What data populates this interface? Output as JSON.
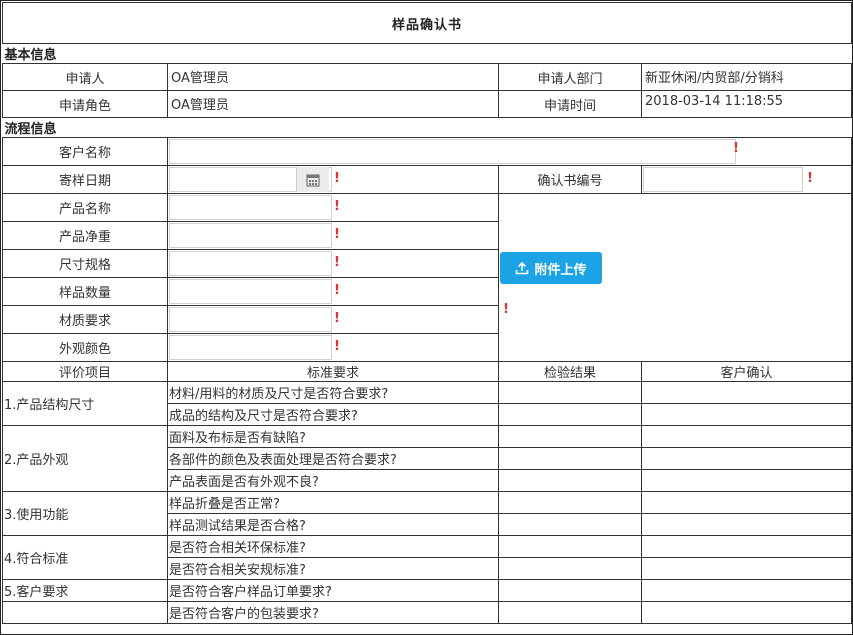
{
  "title": "样品确认书",
  "basic": {
    "section": "基本信息",
    "applicant_label": "申请人",
    "applicant_value": "OA管理员",
    "dept_label": "申请人部门",
    "dept_value": "新亚休闲/内贸部/分销科",
    "role_label": "申请角色",
    "role_value": "OA管理员",
    "time_label": "申请时间",
    "time_value": "2018-03-14 11:18:55"
  },
  "flow": {
    "section": "流程信息",
    "customer_name_label": "客户名称",
    "send_date_label": "寄样日期",
    "confirm_no_label": "确认书编号",
    "product_name_label": "产品名称",
    "net_weight_label": "产品净重",
    "size_label": "尺寸规格",
    "qty_label": "样品数量",
    "material_label": "材质要求",
    "color_label": "外观颜色",
    "upload_label": "附件上传",
    "required_mark": "!"
  },
  "eval": {
    "headers": [
      "评价项目",
      "标准要求",
      "检验结果",
      "客户确认"
    ],
    "groups": [
      {
        "item": "1.产品结构尺寸",
        "rows": [
          "材料/用料的材质及尺寸是否符合要求?",
          "成品的结构及尺寸是否符合要求?"
        ]
      },
      {
        "item": "2.产品外观",
        "rows": [
          "面料及布标是否有缺陷?",
          "各部件的颜色及表面处理是否符合要求?",
          "产品表面是否有外观不良?"
        ]
      },
      {
        "item": "3.使用功能",
        "rows": [
          "样品折叠是否正常?",
          "样品测试结果是否合格?"
        ]
      },
      {
        "item": "4.符合标准",
        "rows": [
          "是否符合相关环保标准?",
          "是否符合相关安规标准?"
        ]
      },
      {
        "item": "5.客户要求",
        "rows": [
          "是否符合客户样品订单要求?",
          "是否符合客户的包装要求?"
        ]
      }
    ]
  },
  "colors": {
    "accent": "#1ba3e6",
    "required": "#e03030",
    "border": "#333333"
  }
}
